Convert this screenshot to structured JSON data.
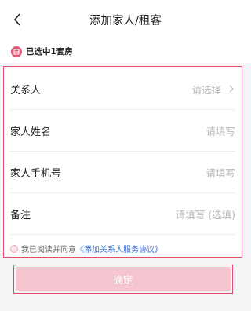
{
  "header": {
    "title": "添加家人/租客",
    "back_icon": "chevron-left-icon"
  },
  "selection": {
    "icon": "house-icon",
    "text": "已选中1套房"
  },
  "form": {
    "fields": [
      {
        "label": "关系人",
        "placeholder": "请选择",
        "has_arrow": true
      },
      {
        "label": "家人姓名",
        "placeholder": "请填写"
      },
      {
        "label": "家人手机号",
        "placeholder": "请填写"
      },
      {
        "label": "备注",
        "placeholder": "请填写 (选填)"
      }
    ]
  },
  "agreement": {
    "prefix": "我已阅读并同意",
    "link": "《添加关系人服务协议》"
  },
  "confirm": {
    "label": "确定"
  },
  "colors": {
    "accent": "#e34f6b",
    "badge": "#e25a76",
    "button_disabled": "#f5c6cf",
    "link": "#3a6fd8"
  }
}
